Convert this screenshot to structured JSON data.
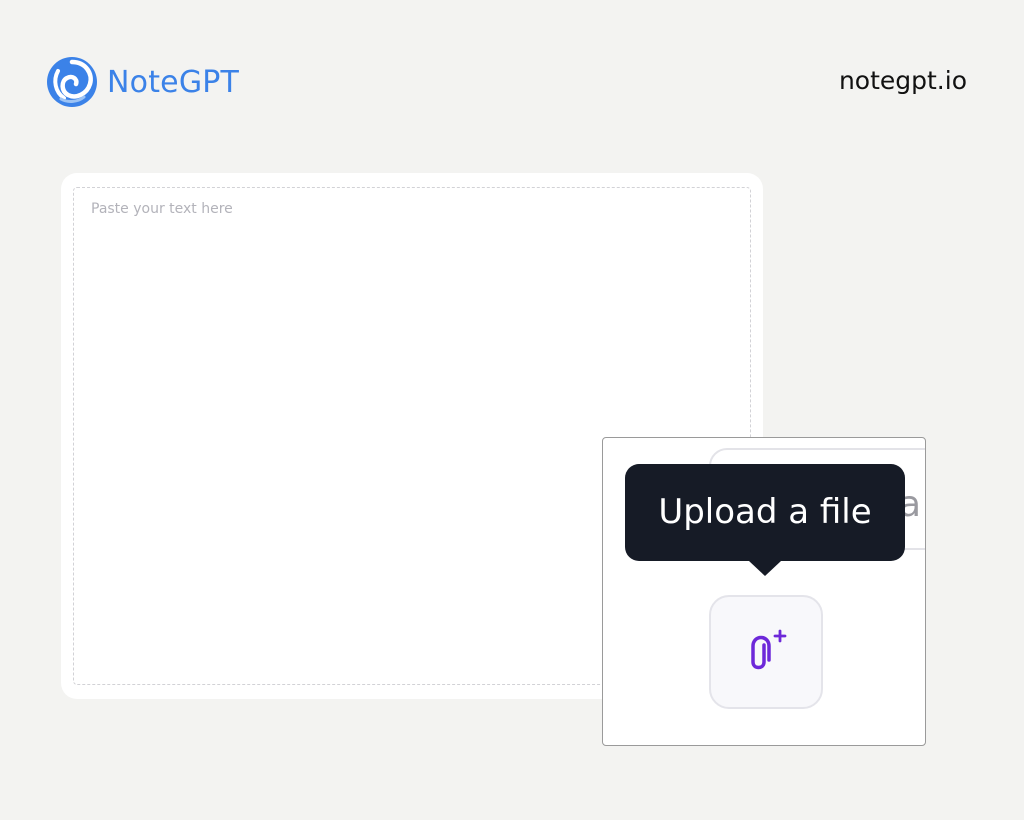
{
  "header": {
    "brand_name": "NoteGPT",
    "site_url": "notegpt.io"
  },
  "editor": {
    "placeholder": "Paste your text here",
    "value": ""
  },
  "zoom": {
    "tooltip": "Upload a file",
    "ghost_button_partial_text": "a"
  },
  "icons": {
    "logo": "swirl-logo-icon",
    "upload": "paperclip-plus-icon"
  },
  "colors": {
    "brand": "#3b82e8",
    "accent": "#6d28d9",
    "tooltip_bg": "#161b26",
    "page_bg": "#f3f3f1"
  }
}
